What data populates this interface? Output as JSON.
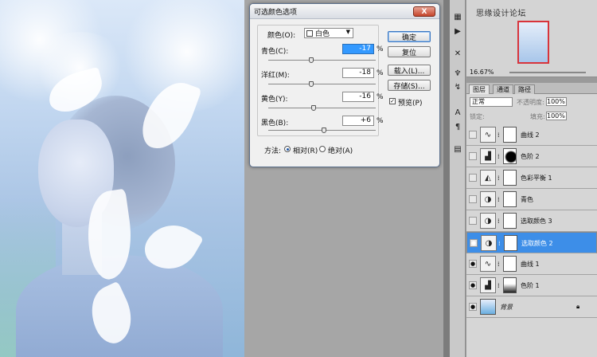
{
  "dialog": {
    "title": "可选颜色选项",
    "close_label": "X",
    "colors_label": "颜色(O):",
    "colors_value": "白色",
    "sliders": [
      {
        "label": "青色(C):",
        "value": "-17",
        "highlight": true,
        "pos": 0.4
      },
      {
        "label": "洋红(M):",
        "value": "-18",
        "highlight": false,
        "pos": 0.4
      },
      {
        "label": "黄色(Y):",
        "value": "-16",
        "highlight": false,
        "pos": 0.42
      },
      {
        "label": "黑色(B):",
        "value": "+6",
        "highlight": false,
        "pos": 0.52
      }
    ],
    "percent": "%",
    "buttons": [
      "确定",
      "复位",
      "载入(L)...",
      "存储(S)..."
    ],
    "preview_label": "预览(P)",
    "method_label": "方法:",
    "method_relative": "相对(R)",
    "method_absolute": "绝对(A)"
  },
  "navigator": {
    "watermark": "思缘设计论坛",
    "zoom": "16.67%"
  },
  "layers_panel": {
    "tabs": [
      "图层",
      "通道",
      "路径"
    ],
    "blend_mode": "正常",
    "opacity_label": "不透明度:",
    "opacity_value": "100%",
    "lock_label": "锁定:",
    "fill_label": "填充:",
    "fill_value": "100%",
    "layers": [
      {
        "name": "曲线 2",
        "icon": "curves-icon",
        "mask": "white",
        "visible": false,
        "selected": false
      },
      {
        "name": "色阶 2",
        "icon": "levels-icon",
        "mask": "dark",
        "visible": false,
        "selected": false
      },
      {
        "name": "色彩平衡 1",
        "icon": "balance-icon",
        "mask": "white",
        "visible": false,
        "selected": false
      },
      {
        "name": "青色",
        "icon": "adjust-icon",
        "mask": "white",
        "visible": false,
        "selected": false
      },
      {
        "name": "选取颜色 3",
        "icon": "adjust-icon",
        "mask": "white",
        "visible": false,
        "selected": false
      },
      {
        "name": "选取颜色 2",
        "icon": "adjust-icon",
        "mask": "white",
        "visible": true,
        "selected": true
      },
      {
        "name": "曲线 1",
        "icon": "curves-icon",
        "mask": "white",
        "visible": true,
        "selected": false
      },
      {
        "name": "色阶 1",
        "icon": "levels-icon",
        "mask": "grad",
        "visible": true,
        "selected": false
      },
      {
        "name": "背景",
        "icon": "image-thumb",
        "mask": "none",
        "visible": true,
        "selected": false
      }
    ]
  }
}
